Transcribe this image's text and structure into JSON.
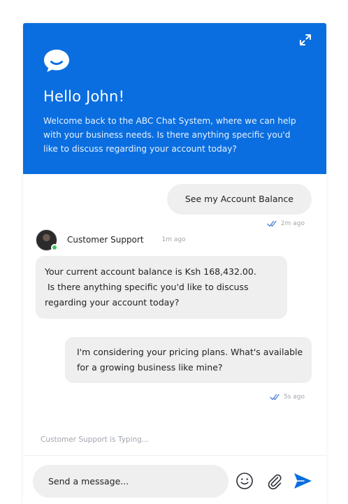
{
  "header": {
    "greeting": "Hello John!",
    "welcome": "Welcome back to the ABC Chat System, where we can help with your business needs. Is there anything specific you'd like to discuss regarding your account today?",
    "logo_icon": "chat-bubble-icon",
    "expand_icon": "expand-icon"
  },
  "colors": {
    "brand": "#0a6ee0",
    "bubble": "#efefef",
    "online": "#3cc55a",
    "muted": "#a0a6ad"
  },
  "messages": {
    "m1": {
      "text": "See my Account Balance",
      "time": "2m ago",
      "status_icon": "double-check-icon"
    },
    "agent": {
      "name": "Customer Support",
      "time": "1m ago",
      "status": "online"
    },
    "m2": {
      "line1": "Your current account balance is Ksh 168,432.00.",
      "line2": " Is there anything specific you'd like to discuss",
      "line3": "regarding your account today?"
    },
    "m3": {
      "line1": "I'm considering your pricing plans. What's available",
      "line2": "for a growing business like mine?",
      "time": "5s ago",
      "status_icon": "double-check-icon"
    }
  },
  "typing": "Customer Support is Typing...",
  "composer": {
    "placeholder": "Send a message...",
    "emoji_icon": "emoji-icon",
    "attach_icon": "paperclip-icon",
    "send_icon": "send-icon"
  }
}
